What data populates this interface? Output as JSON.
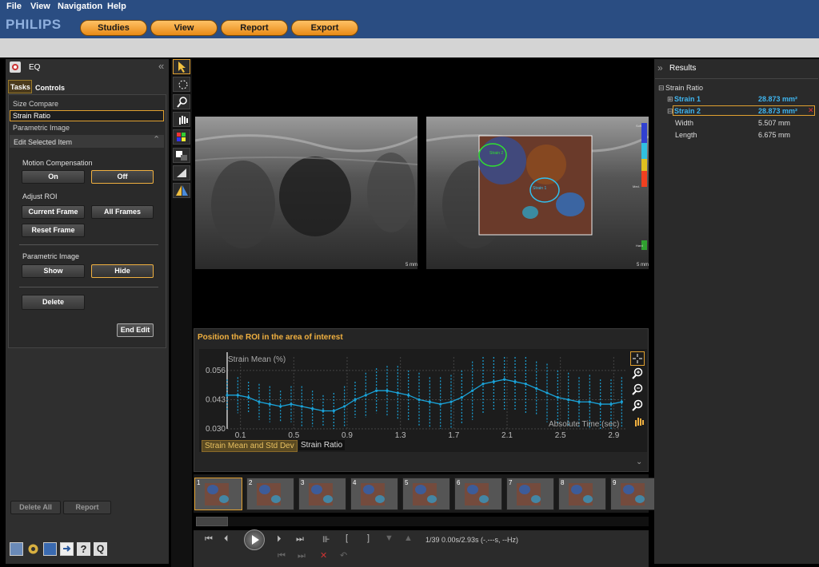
{
  "menu": {
    "file": "File",
    "view": "View",
    "navigation": "Navigation",
    "help": "Help"
  },
  "brand": "PHILIPS",
  "main_buttons": {
    "studies": "Studies",
    "view": "View",
    "report": "Report",
    "export": "Export"
  },
  "left_panel": {
    "title": "EQ",
    "tabs": {
      "tasks": "Tasks",
      "controls": "Controls"
    },
    "task_list": {
      "size_compare": "Size Compare",
      "strain_ratio": "Strain Ratio",
      "parametric_image": "Parametric Image"
    },
    "edit_header": "Edit Selected Item",
    "motion_compensation": {
      "label": "Motion Compensation",
      "on": "On",
      "off": "Off",
      "selected": "Off"
    },
    "adjust_roi": {
      "label": "Adjust ROI",
      "current_frame": "Current Frame",
      "all_frames": "All Frames",
      "reset_frame": "Reset Frame"
    },
    "parametric_image": {
      "label": "Parametric Image",
      "show": "Show",
      "hide": "Hide",
      "selected": "Hide"
    },
    "delete": "Delete",
    "end_edit": "End Edit",
    "delete_all": "Delete All",
    "report": "Report"
  },
  "images": {
    "scale_left": "5 mm",
    "scale_right": "5 mm",
    "roi_labels": {
      "strain2": "Strain 2",
      "strain1": "Strain 1"
    },
    "colorbar": {
      "top": "Soft",
      "mid": "Med.",
      "bottom": "Hard"
    }
  },
  "chart_panel": {
    "instruction": "Position the ROI in the area of interest",
    "tabs": {
      "mean_std": "Strain Mean and Std Dev",
      "ratio": "Strain Ratio"
    }
  },
  "chart_data": {
    "type": "line",
    "ylabel": "Strain Mean (%)",
    "xlabel": "Absolute Time (sec)",
    "ylim": [
      0.03,
      0.062
    ],
    "xlim": [
      0.0,
      3.0
    ],
    "yticks": [
      "0.056",
      "0.043",
      "0.030"
    ],
    "ytick_values": [
      0.056,
      0.043,
      0.03
    ],
    "xticks": [
      "0.1",
      "0.5",
      "0.9",
      "1.3",
      "1.7",
      "2.1",
      "2.5",
      "2.9"
    ],
    "xtick_values": [
      0.1,
      0.5,
      0.9,
      1.3,
      1.7,
      2.1,
      2.5,
      2.9
    ],
    "series": [
      {
        "x": [
          0.0,
          0.08,
          0.16,
          0.24,
          0.32,
          0.4,
          0.48,
          0.56,
          0.64,
          0.72,
          0.8,
          0.88,
          0.96,
          1.04,
          1.12,
          1.2,
          1.28,
          1.36,
          1.44,
          1.52,
          1.6,
          1.68,
          1.76,
          1.84,
          1.92,
          2.0,
          2.08,
          2.16,
          2.24,
          2.32,
          2.4,
          2.48,
          2.56,
          2.64,
          2.72,
          2.8,
          2.88,
          2.96
        ],
        "values": [
          0.045,
          0.045,
          0.044,
          0.042,
          0.041,
          0.04,
          0.041,
          0.04,
          0.039,
          0.038,
          0.038,
          0.04,
          0.043,
          0.045,
          0.047,
          0.047,
          0.046,
          0.045,
          0.043,
          0.042,
          0.041,
          0.042,
          0.044,
          0.047,
          0.05,
          0.051,
          0.052,
          0.051,
          0.05,
          0.048,
          0.046,
          0.044,
          0.043,
          0.042,
          0.042,
          0.041,
          0.041,
          0.042
        ],
        "stdev": [
          0.007,
          0.008,
          0.007,
          0.008,
          0.008,
          0.007,
          0.008,
          0.009,
          0.008,
          0.007,
          0.008,
          0.009,
          0.008,
          0.01,
          0.01,
          0.011,
          0.012,
          0.011,
          0.012,
          0.011,
          0.012,
          0.012,
          0.012,
          0.013,
          0.013,
          0.013,
          0.014,
          0.013,
          0.013,
          0.012,
          0.013,
          0.012,
          0.012,
          0.011,
          0.012,
          0.011,
          0.011,
          0.011
        ]
      }
    ],
    "color": "#1aa3d9"
  },
  "playback": {
    "status": "1/39  0.00s/2.93s (-.---s, --Hz)"
  },
  "thumbnails": [
    "1",
    "2",
    "3",
    "4",
    "5",
    "6",
    "7",
    "8",
    "9"
  ],
  "results": {
    "title": "Results",
    "group": "Strain Ratio",
    "items": [
      {
        "name": "Strain 1",
        "value": "28.873 mm²"
      },
      {
        "name": "Strain 2",
        "value": "28.873 mm²"
      }
    ],
    "details": [
      {
        "name": "Width",
        "value": "5.507 mm"
      },
      {
        "name": "Length",
        "value": "6.675 mm"
      }
    ]
  },
  "colors": {
    "accent": "#e0a030",
    "menubar": "#2a4d82",
    "series": "#1aa3d9",
    "link": "#3fb6f0"
  }
}
